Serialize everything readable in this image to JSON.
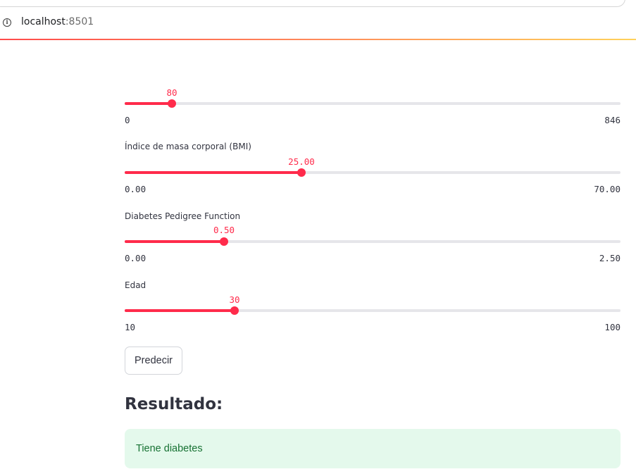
{
  "browser": {
    "url_host": "localhost",
    "url_port": ":8501",
    "info_icon": "info-icon"
  },
  "sliders": [
    {
      "label": "",
      "value": "80",
      "min": "0",
      "max": "846",
      "fraction": 0.0946
    },
    {
      "label": "Índice de masa corporal (BMI)",
      "value": "25.00",
      "min": "0.00",
      "max": "70.00",
      "fraction": 0.357
    },
    {
      "label": "Diabetes Pedigree Function",
      "value": "0.50",
      "min": "0.00",
      "max": "2.50",
      "fraction": 0.2
    },
    {
      "label": "Edad",
      "value": "30",
      "min": "10",
      "max": "100",
      "fraction": 0.222
    }
  ],
  "predict_button": {
    "label": "Predecir"
  },
  "result": {
    "heading": "Resultado:",
    "message": "Tiene diabetes"
  },
  "colors": {
    "accent": "#ff2b4b",
    "success_bg": "#e4f9ec",
    "success_text": "#177233"
  }
}
